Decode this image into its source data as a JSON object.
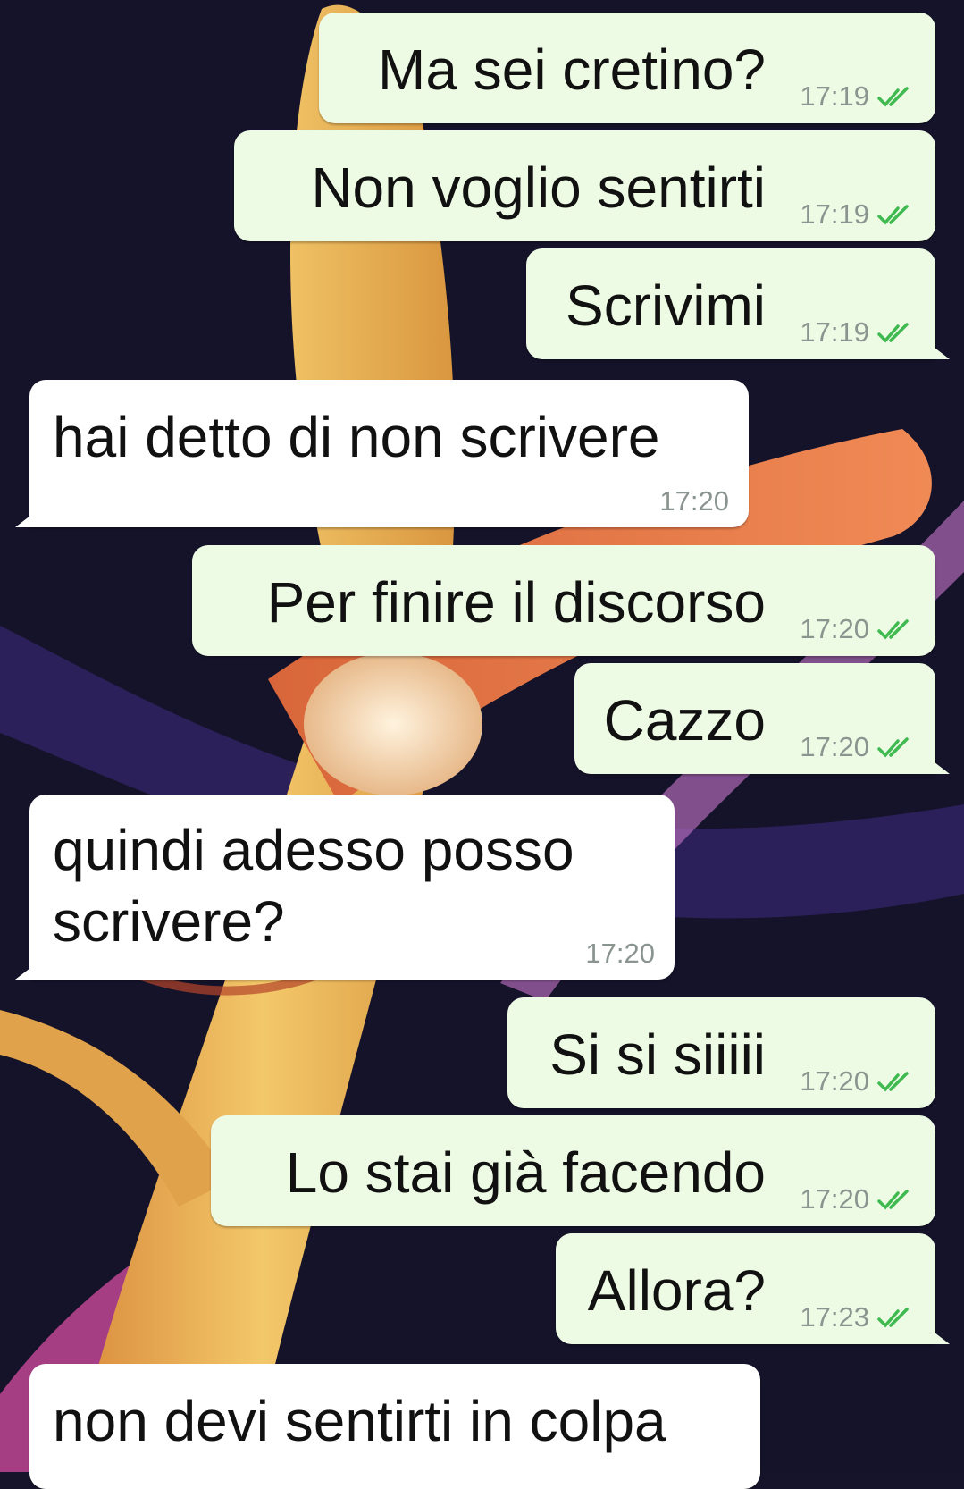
{
  "colors": {
    "outgoing_bubble": "#eefbe4",
    "incoming_bubble": "#ffffff",
    "read_check": "#3fb950",
    "time_text": "#8b9590"
  },
  "messages": [
    {
      "text": "Ma sei cretino?",
      "time": "17:19",
      "direction": "outgoing",
      "status": "read"
    },
    {
      "text": "Non voglio sentirti",
      "time": "17:19",
      "direction": "outgoing",
      "status": "read"
    },
    {
      "text": "Scrivimi",
      "time": "17:19",
      "direction": "outgoing",
      "status": "read"
    },
    {
      "text": "hai detto di non scrivere",
      "time": "17:20",
      "direction": "incoming"
    },
    {
      "text": "Per finire il discorso",
      "time": "17:20",
      "direction": "outgoing",
      "status": "read"
    },
    {
      "text": "Cazzo",
      "time": "17:20",
      "direction": "outgoing",
      "status": "read"
    },
    {
      "text": "quindi adesso posso scrivere?",
      "time": "17:20",
      "direction": "incoming"
    },
    {
      "text": "Si si siiiii",
      "time": "17:20",
      "direction": "outgoing",
      "status": "read"
    },
    {
      "text": "Lo stai già facendo",
      "time": "17:20",
      "direction": "outgoing",
      "status": "read"
    },
    {
      "text": "Allora?",
      "time": "17:23",
      "direction": "outgoing",
      "status": "read"
    },
    {
      "text": "non devi sentirti in colpa",
      "direction": "incoming"
    }
  ]
}
